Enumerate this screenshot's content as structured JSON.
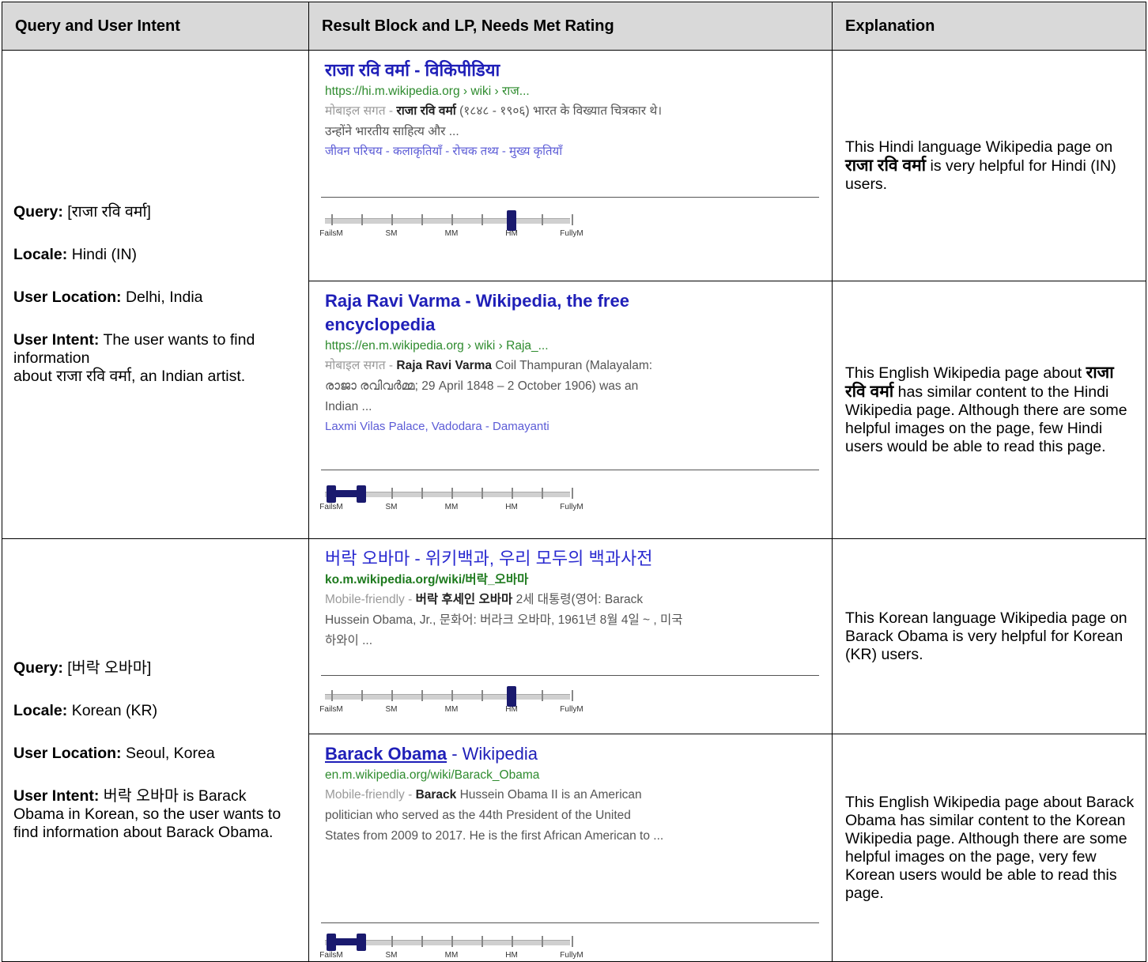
{
  "headers": {
    "col1": "Query and User Intent",
    "col2": "Result Block and LP, Needs Met Rating",
    "col3": "Explanation"
  },
  "groups": [
    {
      "intent": {
        "query_label": "Query:",
        "query_value": "[राजा रवि वर्मा]",
        "locale_label": "Locale:",
        "locale_value": "Hindi (IN)",
        "location_label": "User Location:",
        "location_value": "Delhi, India",
        "intent_label": "User Intent:",
        "intent_line1": "The user wants to find information",
        "intent_line2": "about राजा रवि वर्मा, an Indian artist."
      },
      "results": [
        {
          "title": "राजा रवि वर्मा - विकिपीडिया",
          "url": "https://hi.m.wikipedia.org › wiki › राज...",
          "snippet_label": "मोबाइल सगत -",
          "snippet_bold": "राजा रवि वर्मा",
          "snippet_rest": "(१८४८ - १९०६) भारत के विख्यात चित्रकार थे। उन्होंने भारतीय साहित्य और ...",
          "extra_links": "जीवन परिचय - कलाकृतियाँ - रोचक तथ्य - मुख्य कृतियाँ",
          "rating": {
            "value_low": 3,
            "value_high": 3
          },
          "explanation_pre": "This Hindi language Wikipedia page on",
          "explanation_bold": "राजा रवि वर्मा",
          "explanation_post": "is very helpful for Hindi (IN) users."
        },
        {
          "title": "Raja Ravi Varma - Wikipedia, the free encyclopedia",
          "url": "https://en.m.wikipedia.org › wiki › Raja_...",
          "snippet_label": "मोबाइल सगत -",
          "snippet_bold": "Raja Ravi Varma",
          "snippet_rest": "Coil Thampuran (Malayalam: രാജാ രവിവർമ്മ; 29 April 1848 – 2 October 1906) was an Indian ...",
          "extra_links": "Laxmi Vilas Palace, Vadodara - Damayanti",
          "rating": {
            "value_low": 0,
            "value_high": 0.5
          },
          "explanation_pre": "This English Wikipedia page about",
          "explanation_bold": "राजा रवि वर्मा",
          "explanation_post": "has similar content to the Hindi Wikipedia page.  Although there are some helpful images on the page, few Hindi users would be able to read this page."
        }
      ]
    },
    {
      "intent": {
        "query_label": "Query:",
        "query_value": "[버락 오바마]",
        "locale_label": "Locale:",
        "locale_value": "Korean (KR)",
        "location_label": "User Location:",
        "location_value": "Seoul, Korea",
        "intent_label": "User Intent:",
        "intent_line1": "버락 오바마 is Barack Obama in Korean, so the user wants to find information about Barack Obama.",
        "intent_line2": ""
      },
      "results": [
        {
          "title": "버락 오바마 - 위키백과, 우리 모두의 백과사전",
          "url": "ko.m.wikipedia.org/wiki/버락_오바마",
          "snippet_label": "Mobile-friendly -",
          "snippet_bold": "버락 후세인 오바마",
          "snippet_rest": "2세 대통령(영어: Barack Hussein Obama, Jr., 문화어: 버라크 오바마, 1961년 8월 4일 ~ , 미국 하와이 ...",
          "extra_links": "",
          "rating": {
            "value_low": 3,
            "value_high": 3
          },
          "explanation_pre": "This Korean language Wikipedia page on Barack Obama is very helpful for Korean (KR) users.",
          "explanation_bold": "",
          "explanation_post": ""
        },
        {
          "title": "Barack Obama",
          "title_suffix": "- Wikipedia",
          "url": "en.m.wikipedia.org/wiki/Barack_Obama",
          "snippet_label": "Mobile-friendly -",
          "snippet_bold": "Barack",
          "snippet_rest": "Hussein Obama II is an American politician who served as the 44th President of the United States from 2009 to 2017. He is the first African American to ...",
          "extra_links": "",
          "rating": {
            "value_low": 0,
            "value_high": 0.5
          },
          "explanation_pre": "This English Wikipedia page about Barack Obama has similar content to the Korean Wikipedia page.  Although there are some helpful images on the page, very few Korean users would be able to read this page.",
          "explanation_bold": "",
          "explanation_post": ""
        }
      ]
    }
  ],
  "scale_labels": [
    "FailsM",
    "SM",
    "MM",
    "HM",
    "FullyM"
  ]
}
